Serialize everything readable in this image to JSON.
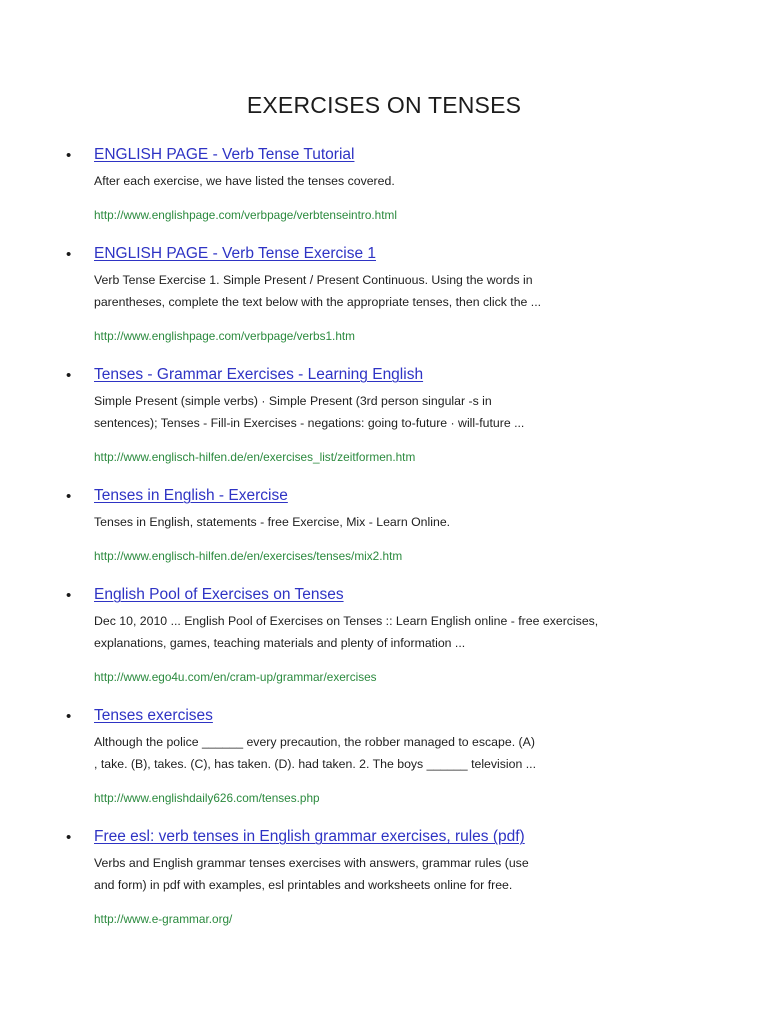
{
  "page": {
    "title": "EXERCISES ON TENSES"
  },
  "results": [
    {
      "title": "ENGLISH PAGE - Verb Tense Tutorial",
      "snippet": "After each exercise, we have listed the tenses covered.",
      "url": "http://www.englishpage.com/verbpage/verbtenseintro.html"
    },
    {
      "title": "ENGLISH PAGE - Verb Tense Exercise 1",
      "snippet": "Verb Tense Exercise 1. Simple Present / Present Continuous. Using the words in\nparentheses, complete the text below with the appropriate tenses, then click the ...",
      "url": "http://www.englishpage.com/verbpage/verbs1.htm"
    },
    {
      "title": "Tenses - Grammar Exercises - Learning English",
      "snippet": "Simple Present (simple verbs) · Simple Present (3rd person singular -s in\nsentences); Tenses - Fill-in Exercises - negations: going to-future · will-future ...",
      "url": "http://www.englisch-hilfen.de/en/exercises_list/zeitformen.htm"
    },
    {
      "title": "Tenses in English - Exercise",
      "snippet": "Tenses in English, statements - free Exercise, Mix - Learn Online.",
      "url": "http://www.englisch-hilfen.de/en/exercises/tenses/mix2.htm"
    },
    {
      "title": "English Pool of Exercises on Tenses",
      "snippet": "Dec 10, 2010 ... English Pool of Exercises on Tenses :: Learn English online - free exercises,\nexplanations, games, teaching materials and plenty of information ...",
      "url": "http://www.ego4u.com/en/cram-up/grammar/exercises"
    },
    {
      "title": "Tenses exercises",
      "snippet": "Although the police ______ every precaution, the robber managed to escape. (A)\n, take. (B), takes. (C), has taken. (D). had taken. 2. The boys ______ television ...",
      "url": "http://www.englishdaily626.com/tenses.php"
    },
    {
      "title": "Free esl: verb tenses in English grammar exercises, rules (pdf)",
      "snippet": "Verbs and English grammar tenses exercises with answers, grammar rules (use\nand form) in pdf with examples, esl printables and worksheets online for free.",
      "url": "http://www.e-grammar.org/"
    }
  ],
  "bullet_glyph": "•",
  "colors": {
    "title_link": "#2e33c4",
    "url": "#2b8a3e",
    "text": "#1e1e1e"
  }
}
